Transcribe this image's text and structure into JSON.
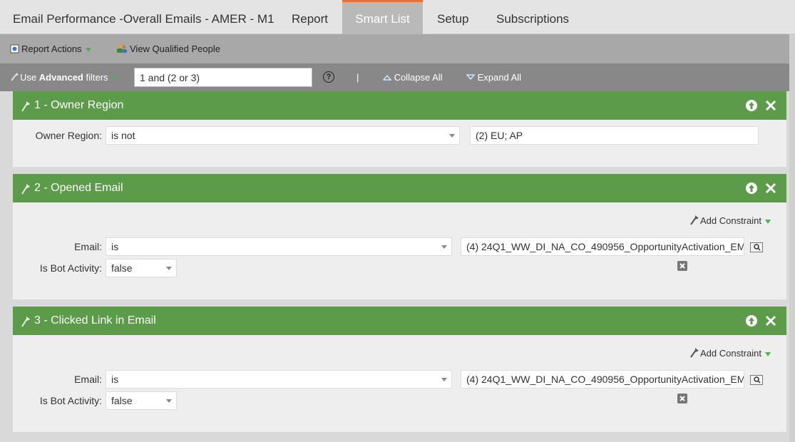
{
  "tabs": [
    {
      "label": "Email Performance -Overall Emails - AMER - M1",
      "active": false
    },
    {
      "label": "Report",
      "active": false
    },
    {
      "label": "Smart List",
      "active": true
    },
    {
      "label": "Setup",
      "active": false
    },
    {
      "label": "Subscriptions",
      "active": false
    }
  ],
  "actions": {
    "report_actions": "Report Actions",
    "view_qualified": "View Qualified People"
  },
  "filterbar": {
    "use": "Use ",
    "advanced": "Advanced",
    "filters": " filters",
    "logic": "1 and (2 or 3)",
    "help": "?",
    "separator": "|",
    "collapse_all": "Collapse All",
    "expand_all": "Expand All"
  },
  "filters": [
    {
      "title": "1 - Owner Region",
      "rows": [
        {
          "label": "Owner Region:",
          "operator": "is not",
          "value": "(2) EU; AP"
        }
      ]
    },
    {
      "title": "2 - Opened Email",
      "add_constraint": "Add Constraint",
      "rows": [
        {
          "label": "Email:",
          "operator": "is",
          "value": "(4) 24Q1_WW_DI_NA_CO_490956_OpportunityActivation_EM"
        },
        {
          "label": "Is Bot Activity:",
          "operator": "false"
        }
      ]
    },
    {
      "title": "3 - Clicked Link in Email",
      "add_constraint": "Add Constraint",
      "rows": [
        {
          "label": "Email:",
          "operator": "is",
          "value": "(4) 24Q1_WW_DI_NA_CO_490956_OpportunityActivation_EM"
        },
        {
          "label": "Is Bot Activity:",
          "operator": "false"
        }
      ]
    }
  ],
  "colors": {
    "accent_tab": "#e8733a",
    "panel_header": "#5c9b4a",
    "arrow_green": "#4caf50"
  }
}
